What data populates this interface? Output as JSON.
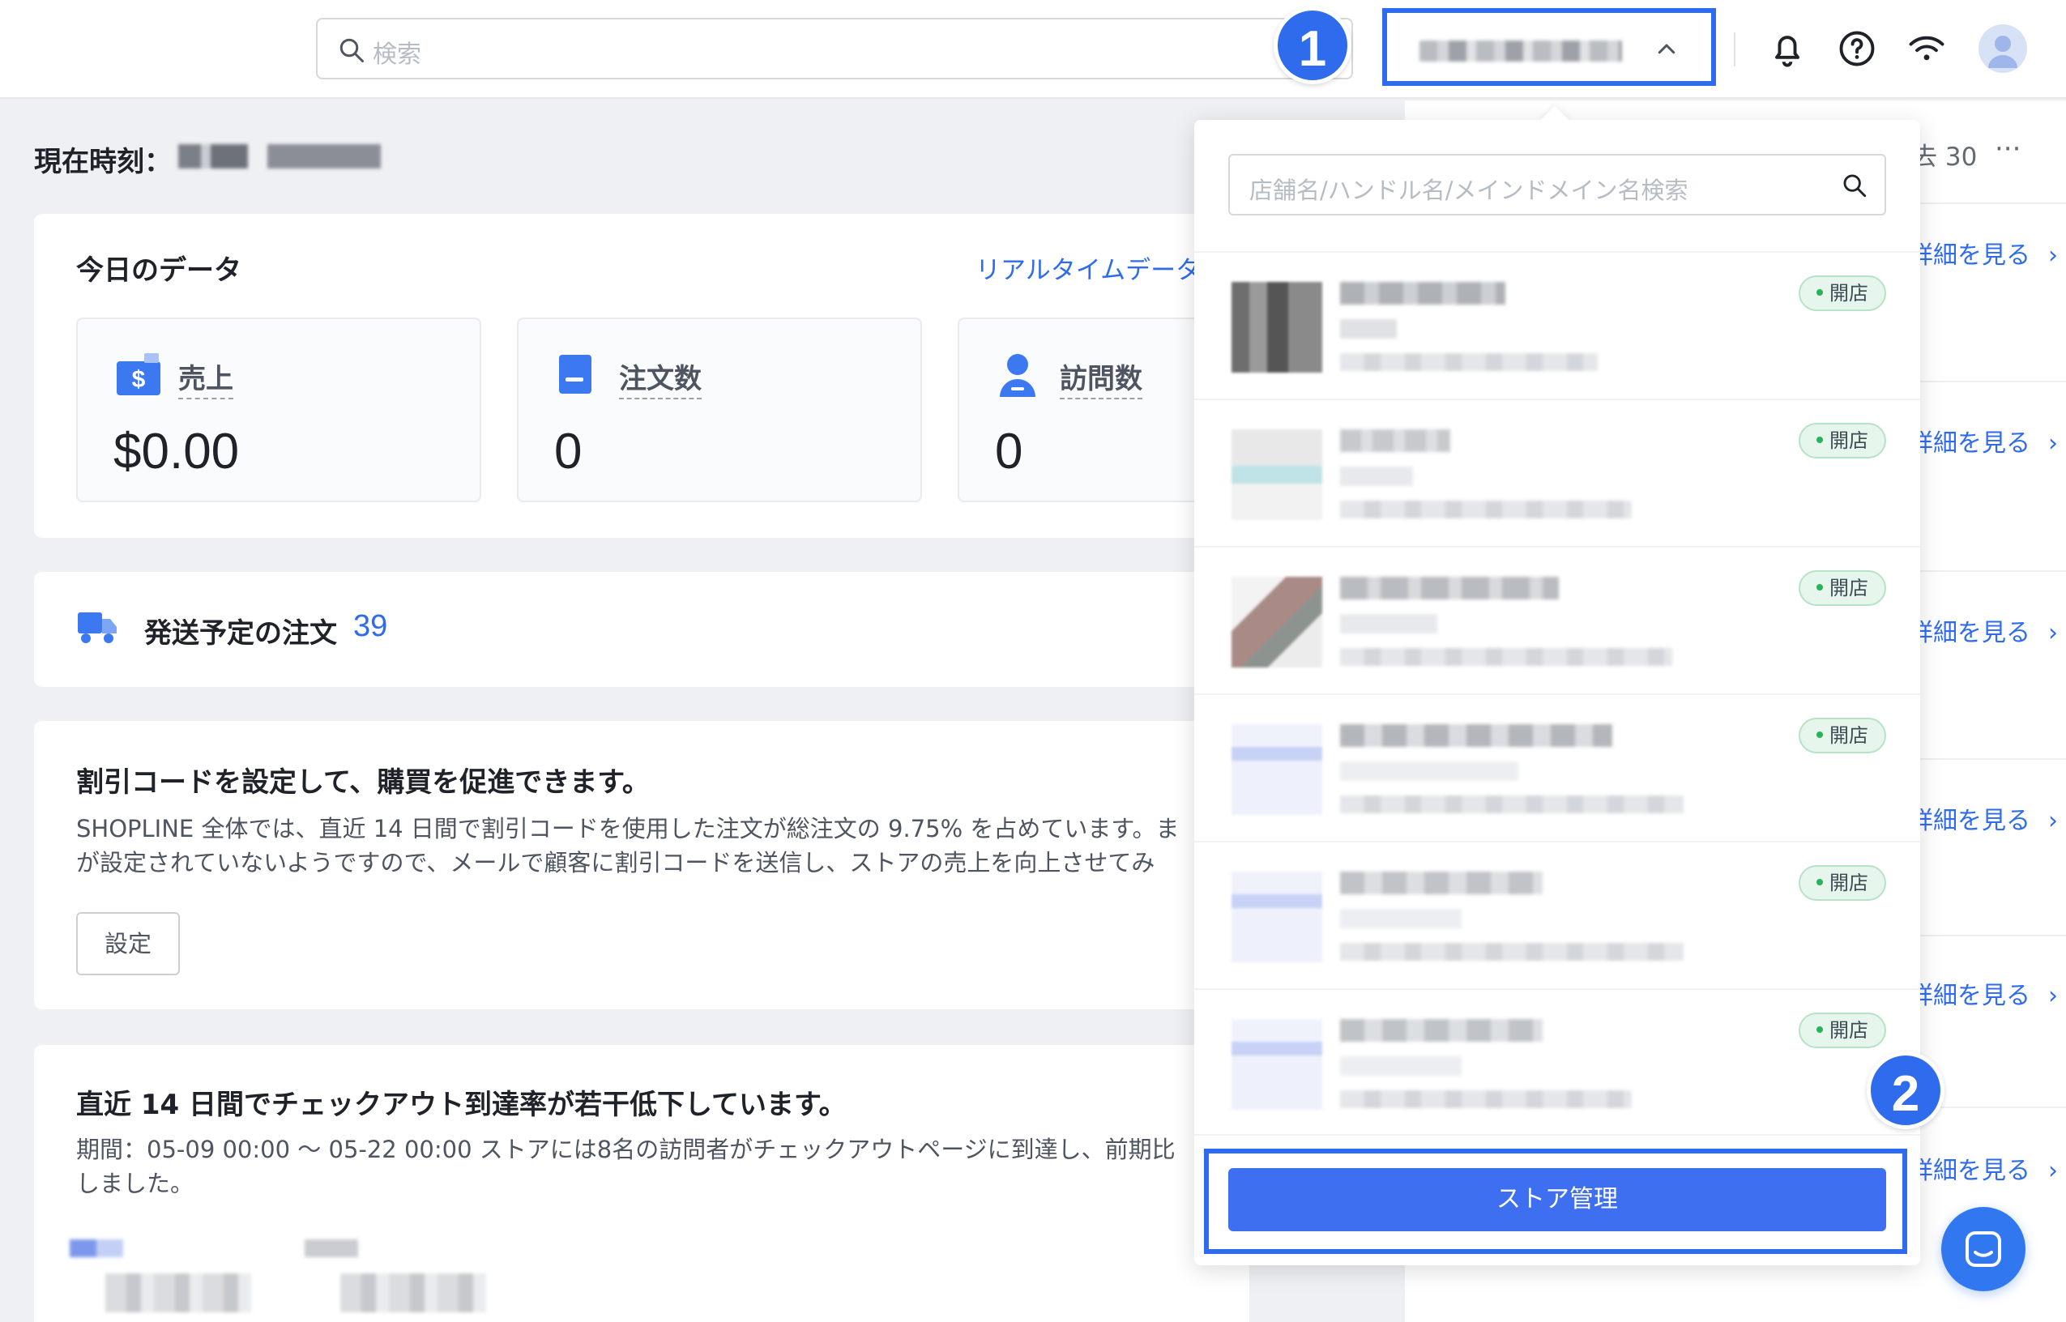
{
  "topbar": {
    "search_placeholder": "検索",
    "step_markers": [
      "1",
      "2"
    ]
  },
  "main": {
    "clock_label": "現在時刻：",
    "today": {
      "title": "今日のデータ",
      "realtime_link": "リアルタイムデータ",
      "stats": [
        {
          "label": "売上",
          "value": "$0.00",
          "icon": "wallet-dollar-icon"
        },
        {
          "label": "注文数",
          "value": "0",
          "icon": "document-icon"
        },
        {
          "label": "訪問数",
          "value": "0",
          "icon": "user-icon"
        }
      ]
    },
    "shipping": {
      "label": "発送予定の注文",
      "count": "39"
    },
    "discount": {
      "title": "割引コードを設定して、購買を促進できます。",
      "body_line1": "SHOPLINE 全体では、直近 14 日間で割引コードを使用した注文が総注文の 9.75% を占めています。ま",
      "body_line2": "が設定されていないようですので、メールで顧客に割引コードを送信し、ストアの売上を向上させてみ",
      "button": "設定"
    },
    "checkout": {
      "title": "直近 14 日間でチェックアウト到達率が若干低下しています。",
      "body_line1": "期間：05-09 00:00 〜 05-22 00:00 ストアには8名の訪問者がチェックアウトページに到達し、前期比",
      "body_line2": "しました。"
    }
  },
  "right_panel": {
    "period_fragment": "去 30",
    "more": "···",
    "view_links": [
      "詳細を見る",
      "詳細を見る",
      "詳細を見る",
      "詳細を見る",
      "詳細を見る",
      "詳細を見る"
    ]
  },
  "store_dropdown": {
    "search_placeholder": "店舗名/ハンドル名/メインドメイン名検索",
    "stores": [
      {
        "status": "開店"
      },
      {
        "status": "開店"
      },
      {
        "status": "開店"
      },
      {
        "status": "開店"
      },
      {
        "status": "開店"
      },
      {
        "status": "開店"
      }
    ],
    "manage_button": "ストア管理"
  },
  "colors": {
    "accent": "#2f6bed",
    "button": "#3e6ff0",
    "badge_bg": "#e6f6ec",
    "badge_dot": "#27b35a",
    "page_bg": "#eef0f3"
  }
}
